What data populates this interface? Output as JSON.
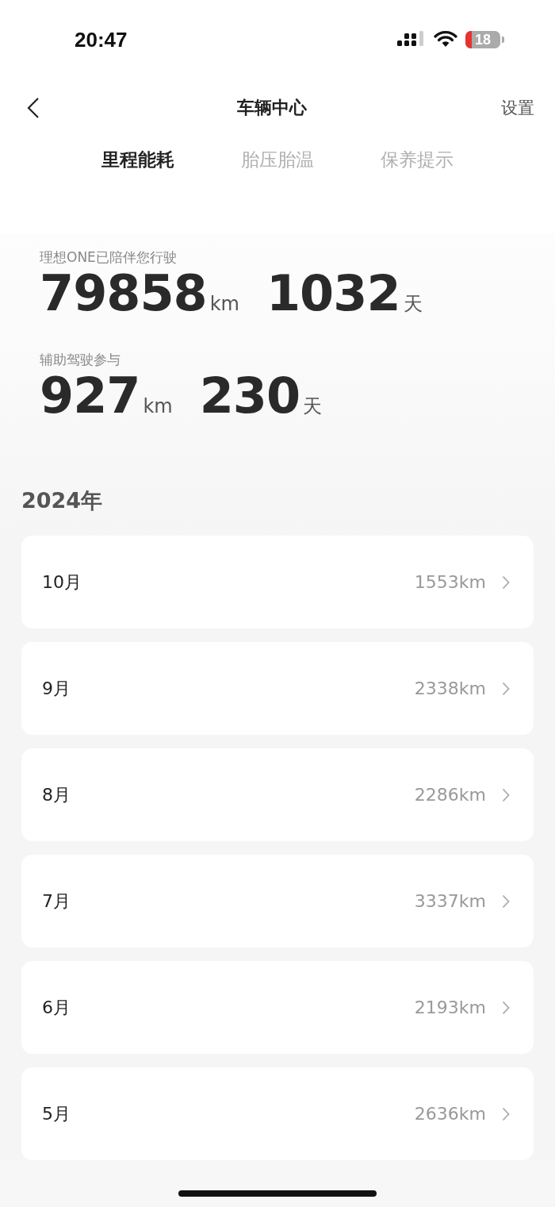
{
  "status_bar": {
    "time": "20:47",
    "battery": "18"
  },
  "nav": {
    "title": "车辆中心",
    "action": "设置"
  },
  "tabs": [
    {
      "label": "里程能耗",
      "selected": true
    },
    {
      "label": "胎压胎温",
      "selected": false
    },
    {
      "label": "保养提示",
      "selected": false
    }
  ],
  "stats": [
    {
      "label": "理想ONE已陪伴您行驶",
      "distance": "79858",
      "distance_unit": "km",
      "days": "1032",
      "days_unit": "天"
    },
    {
      "label": "辅助驾驶参与",
      "distance": "927",
      "distance_unit": "km",
      "days": "230",
      "days_unit": "天"
    }
  ],
  "year": "2024年",
  "months": [
    {
      "month": "10月",
      "distance": "1553km"
    },
    {
      "month": "9月",
      "distance": "2338km"
    },
    {
      "month": "8月",
      "distance": "2286km"
    },
    {
      "month": "7月",
      "distance": "3337km"
    },
    {
      "month": "6月",
      "distance": "2193km"
    },
    {
      "month": "5月",
      "distance": "2636km"
    }
  ]
}
